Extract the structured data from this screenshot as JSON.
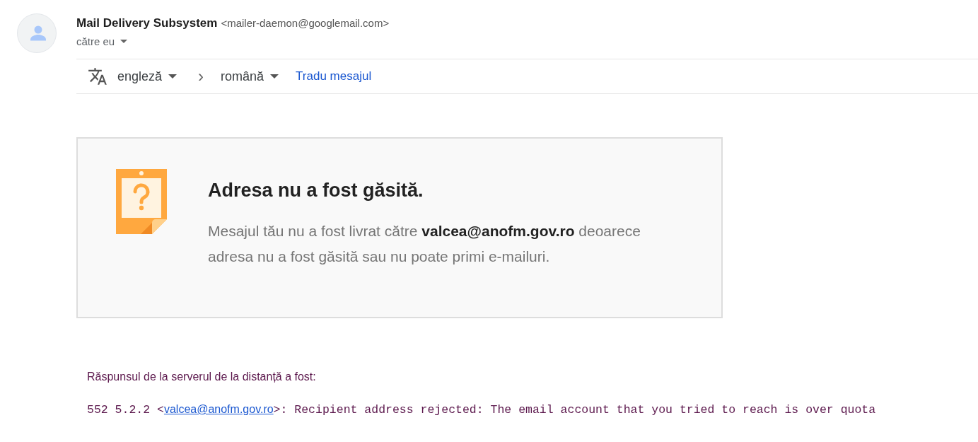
{
  "sender": {
    "name": "Mail Delivery Subsystem",
    "address": "<mailer-daemon@googlemail.com>",
    "recipient_label": "către eu"
  },
  "translate_bar": {
    "source_language": "engleză",
    "separator": "›",
    "target_language": "română",
    "action": "Tradu mesajul"
  },
  "notice": {
    "title": "Adresa nu a fost găsită.",
    "message": "Mesajul tău nu a fost livrat către **valcea@anofm.gov.ro** deoarece adresa nu a fost găsită sau nu poate primi e-mailuri."
  },
  "server_response": {
    "label": "Răspunsul de la serverul de la distanță a fost:",
    "code_prefix": "552 5.2.2 <",
    "address_link": "valcea@anofm.gov.ro",
    "code_suffix": ">: Recipient address rejected: The email account that you tried to reach is over quota"
  }
}
